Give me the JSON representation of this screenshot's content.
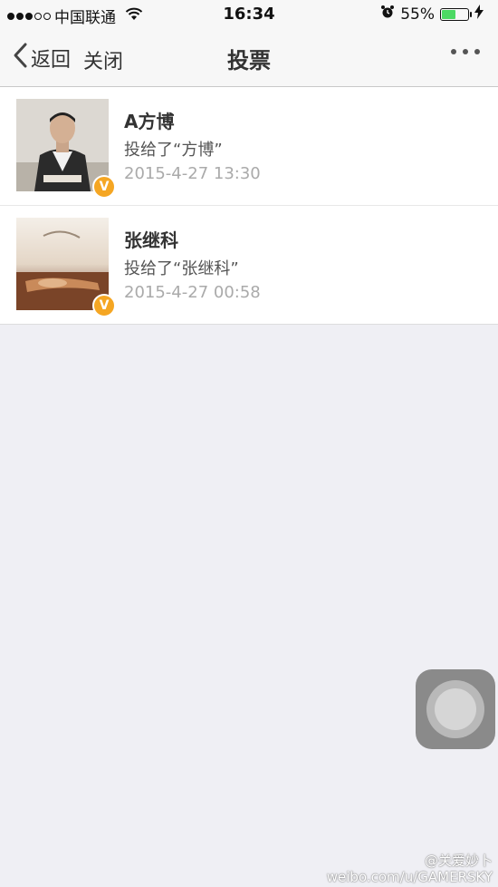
{
  "status_bar": {
    "carrier": "中国联通",
    "time": "16:34",
    "battery_percent": "55%",
    "battery_level": 0.55,
    "signal_bars_filled": 3,
    "signal_bars_total": 5
  },
  "nav": {
    "back_label": "返回",
    "close_label": "关闭",
    "title": "投票"
  },
  "items": [
    {
      "name": "A方博",
      "desc": "投给了“方博”",
      "date": "2015-4-27 13:30",
      "badge": "V"
    },
    {
      "name": "张继科",
      "desc": "投给了“张继科”",
      "date": "2015-4-27 00:58",
      "badge": "V"
    }
  ],
  "watermark": {
    "handle": "@关爱妙卜",
    "url": "weibo.com/u/GAMERSKY"
  },
  "colors": {
    "badge": "#f5a623",
    "battery": "#4cd964",
    "background": "#efeff4"
  },
  "icons": [
    "back-chevron-icon",
    "more-dots-icon",
    "wifi-icon",
    "alarm-icon",
    "charging-bolt-icon",
    "verified-v-icon"
  ]
}
